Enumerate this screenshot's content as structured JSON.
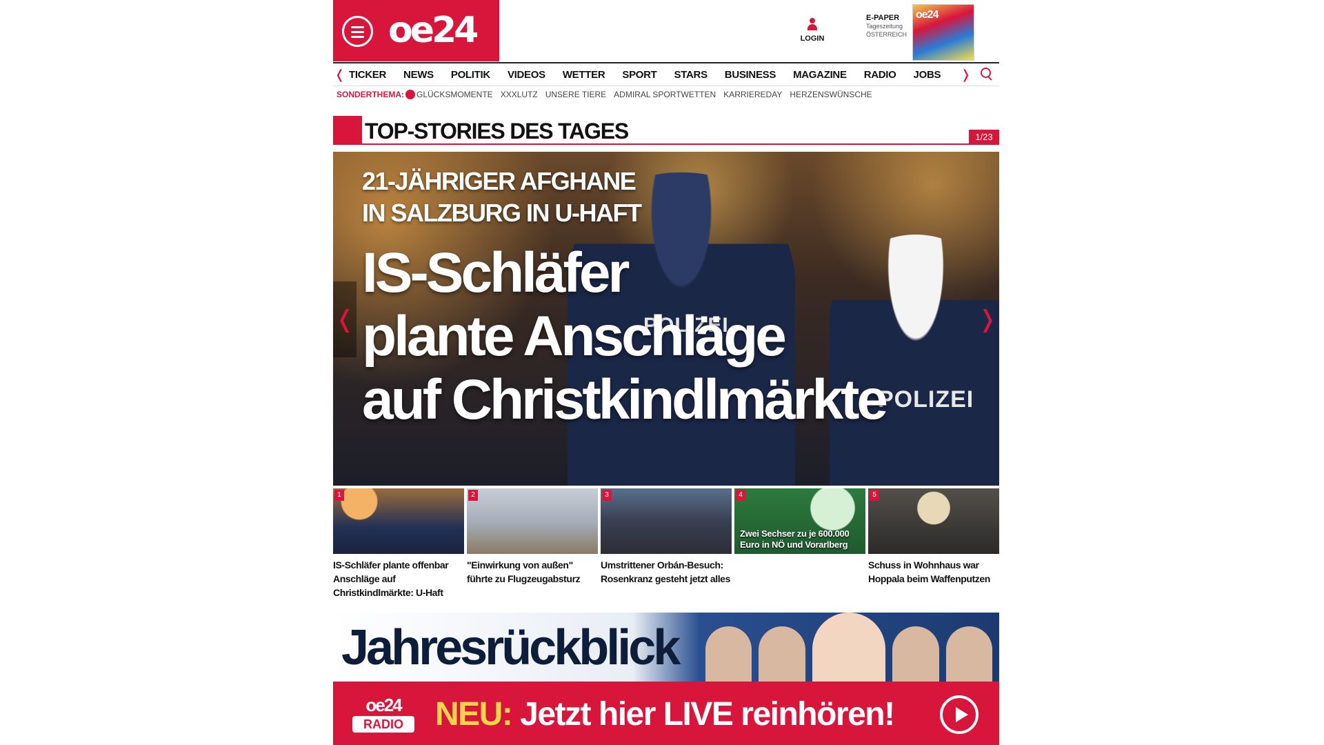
{
  "header": {
    "logo_text": "oe24",
    "login_label": "LOGIN",
    "epaper_title": "E-PAPER",
    "epaper_line1": "Tageszeitung",
    "epaper_line2": "ÖSTERREICH",
    "epaper_cover_logo": "oe24"
  },
  "nav": {
    "items": [
      "TICKER",
      "NEWS",
      "POLITIK",
      "VIDEOS",
      "WETTER",
      "SPORT",
      "STARS",
      "BUSINESS",
      "MAGAZINE",
      "RADIO",
      "JOBS"
    ],
    "prev_arrow": "❬",
    "next_arrow": "❭"
  },
  "subnav": {
    "label": "SONDERTHEMA:",
    "items": [
      "GLÜCKSMOMENTE",
      "XXXLUTZ",
      "UNSERE TIERE",
      "ADMIRAL SPORTWETTEN",
      "KARRIEREDAY",
      "HERZENSWÜNSCHE"
    ]
  },
  "section": {
    "title": "TOP-STORIES DES TAGES",
    "counter": "1/23"
  },
  "hero": {
    "kicker_line1": "21-JÄHRIGER AFGHANE",
    "kicker_line2": "IN SALZBURG IN U-HAFT",
    "headline_line1": "IS-Schläfer",
    "headline_line2": "plante Anschläge",
    "headline_line3": "auf Christkindlmärkte",
    "polizei1": "POLIZEI",
    "polizei2": "POLIZEI",
    "prev_arrow": "❬",
    "next_arrow": "❭"
  },
  "thumbs": [
    {
      "num": "1",
      "caption": "IS-Schläfer plante offenbar Anschläge auf Christkindlmärkte: U-Haft",
      "overlay": ""
    },
    {
      "num": "2",
      "caption": "\"Einwirkung von außen\" führte zu Flugzeugabsturz",
      "overlay": ""
    },
    {
      "num": "3",
      "caption": "Umstrittener Orbán-Besuch: Rosenkranz gesteht jetzt alles",
      "overlay": ""
    },
    {
      "num": "4",
      "caption": "",
      "overlay": "Zwei Sechser zu je 600.000 Euro in NÖ und Vorarlberg"
    },
    {
      "num": "5",
      "caption": "Schuss in Wohnhaus war Hoppala beim Waffenputzen",
      "overlay": ""
    }
  ],
  "banner": {
    "title": "Jahresrückblick"
  },
  "radio": {
    "logo_top": "oe24",
    "logo_bottom": "RADIO",
    "neu": "NEU:",
    "text": "Jetzt hier LIVE reinhören!"
  }
}
